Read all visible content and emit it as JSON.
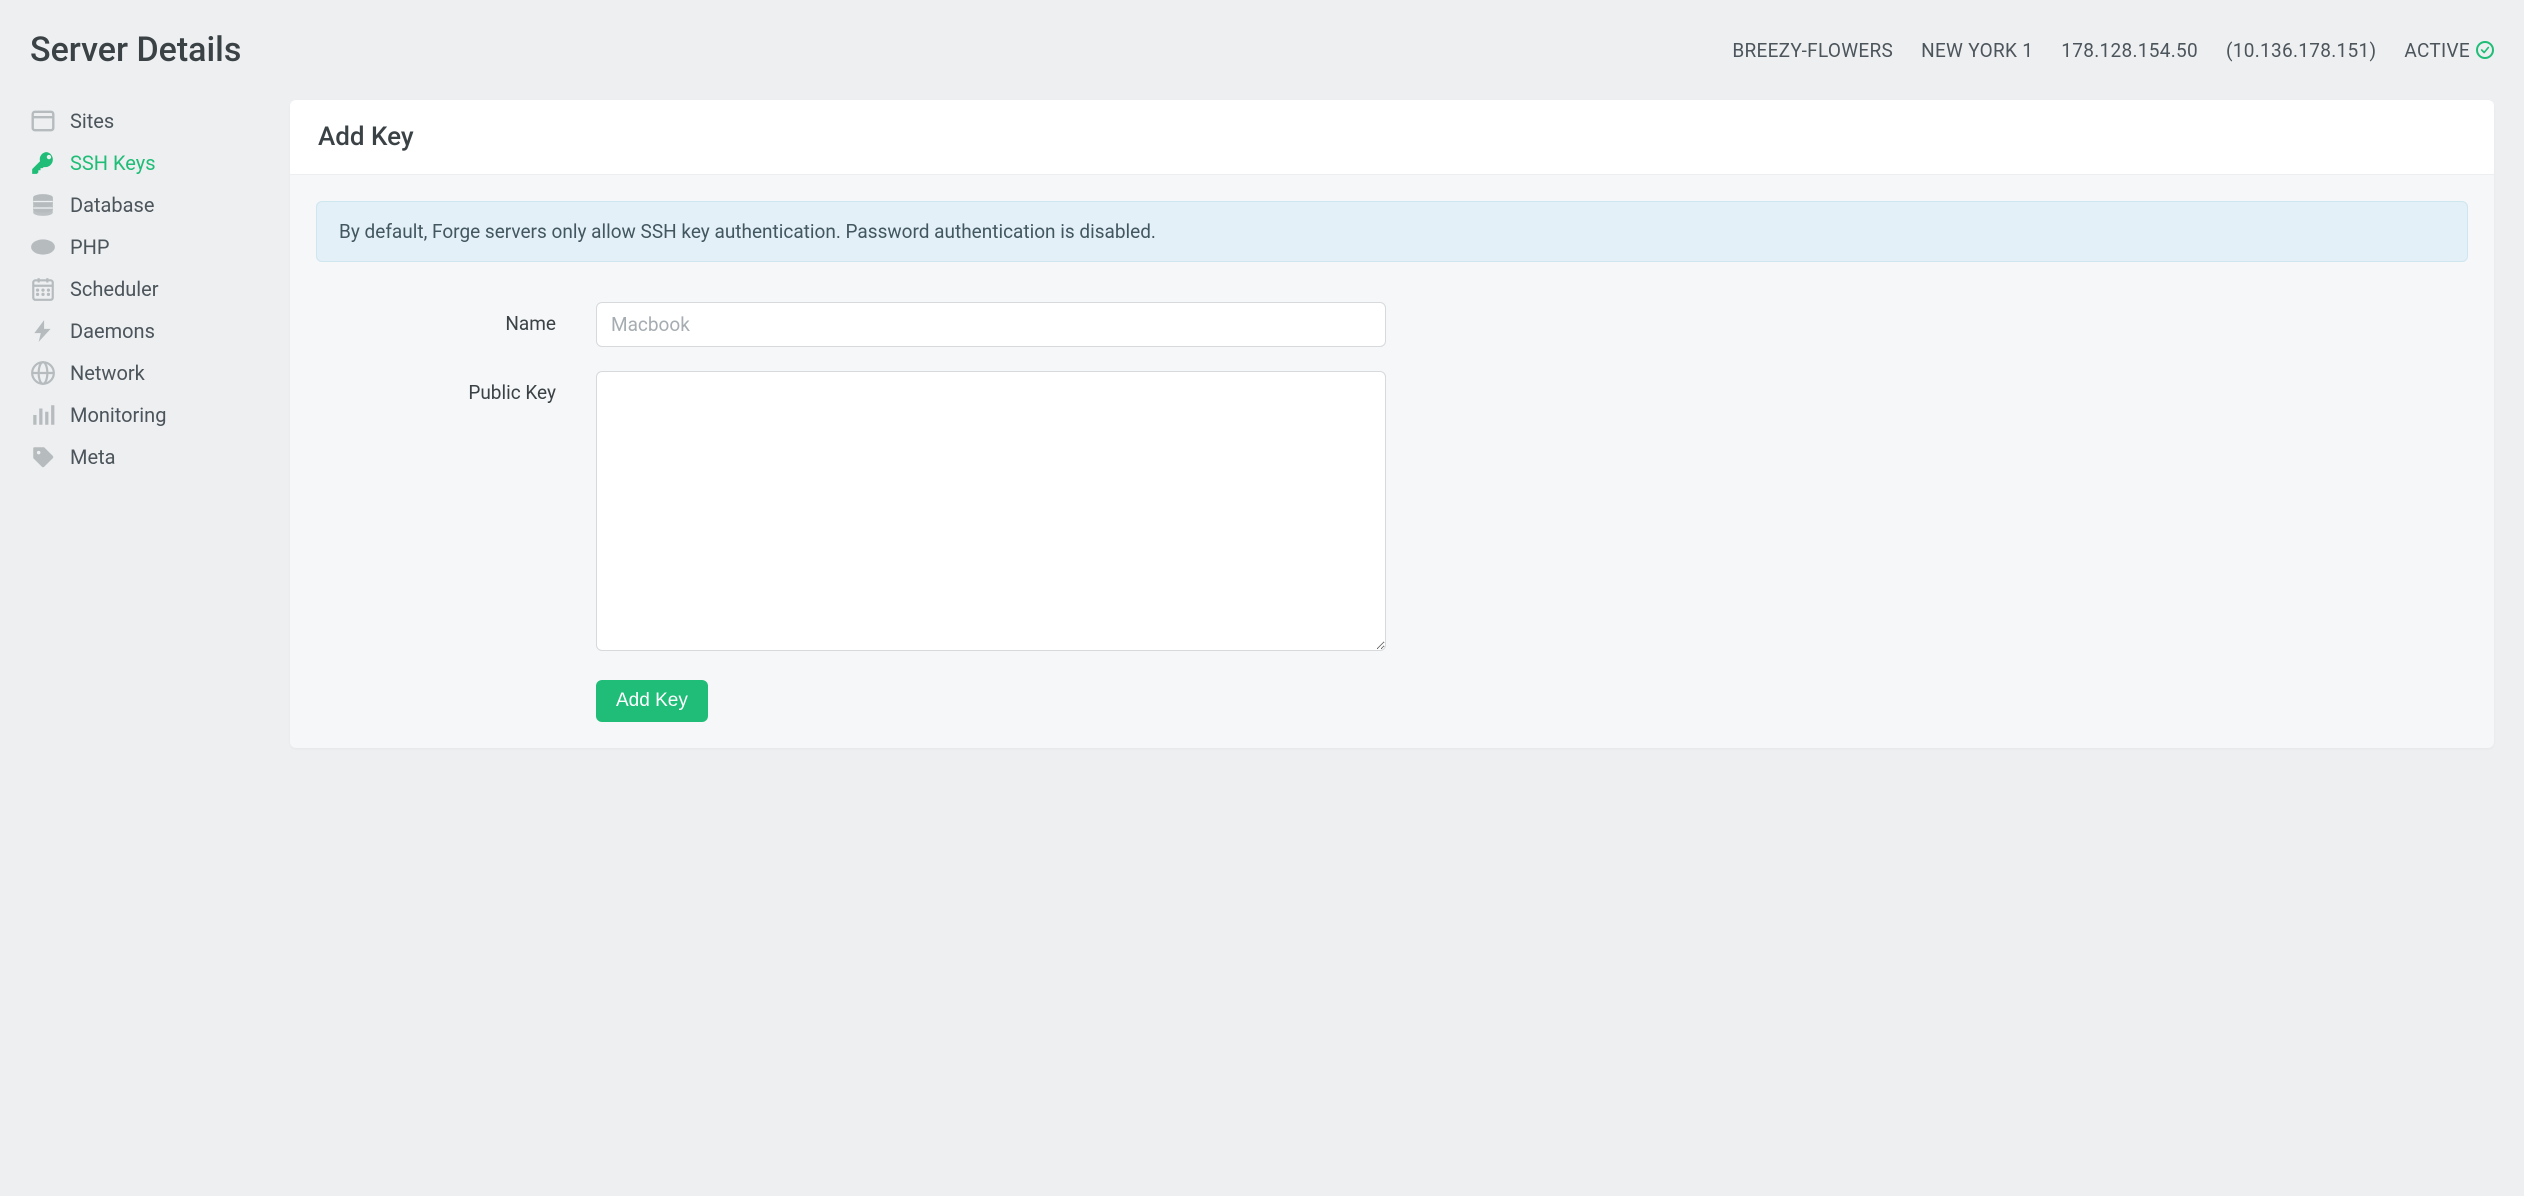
{
  "header": {
    "title": "Server Details",
    "server_name": "BREEZY-FLOWERS",
    "region": "NEW YORK 1",
    "public_ip": "178.128.154.50",
    "private_ip": "(10.136.178.151)",
    "status": "ACTIVE"
  },
  "sidebar": {
    "items": [
      {
        "label": "Sites"
      },
      {
        "label": "SSH Keys"
      },
      {
        "label": "Database"
      },
      {
        "label": "PHP"
      },
      {
        "label": "Scheduler"
      },
      {
        "label": "Daemons"
      },
      {
        "label": "Network"
      },
      {
        "label": "Monitoring"
      },
      {
        "label": "Meta"
      }
    ]
  },
  "main": {
    "card_title": "Add Key",
    "info_text": "By default, Forge servers only allow SSH key authentication. Password authentication is disabled.",
    "form": {
      "name_label": "Name",
      "name_placeholder": "Macbook",
      "public_key_label": "Public Key",
      "submit_label": "Add Key"
    }
  }
}
